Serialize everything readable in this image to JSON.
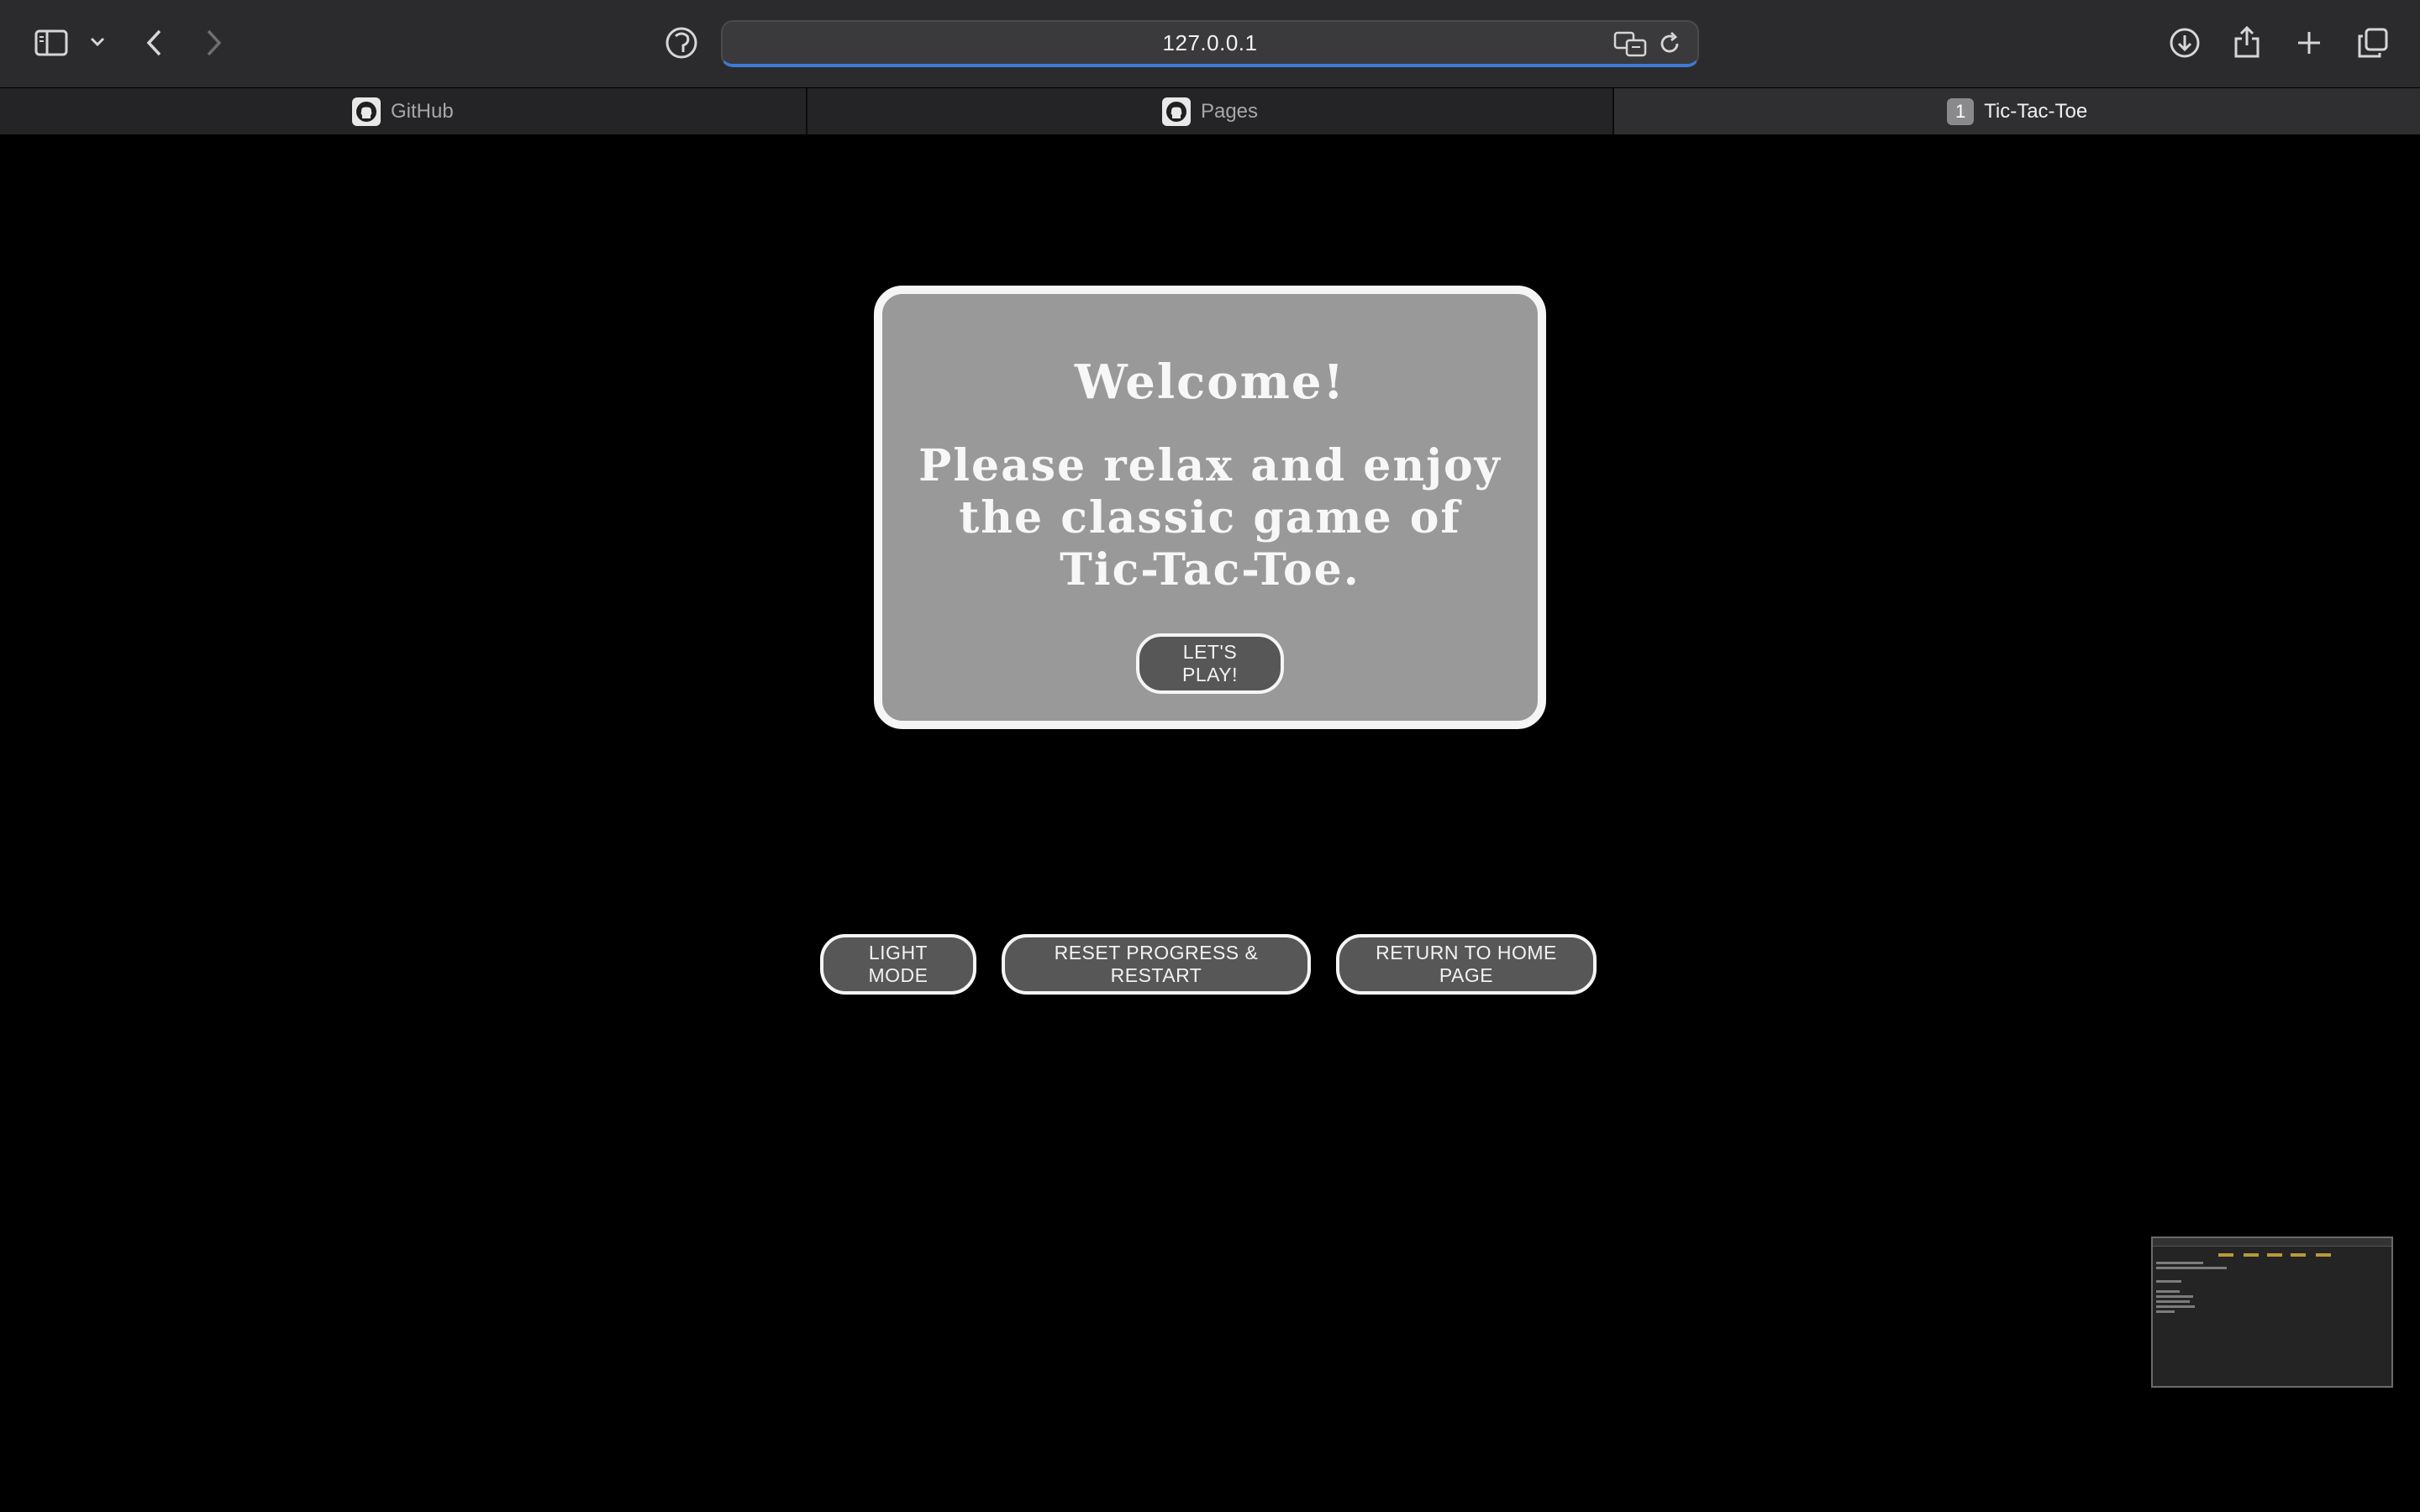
{
  "browser": {
    "url": "127.0.0.1",
    "tabs": [
      {
        "label": "GitHub",
        "icon": "github-icon",
        "active": false
      },
      {
        "label": "Pages",
        "icon": "github-icon",
        "active": false
      },
      {
        "label": "Tic-Tac-Toe",
        "badge": "1",
        "active": true
      }
    ],
    "toolbar_icons": [
      "sidebar-icon",
      "chevron-down-icon",
      "back-icon",
      "forward-icon",
      "privacy-icon",
      "translate-icon",
      "reload-icon",
      "download-icon",
      "share-icon",
      "new-tab-icon",
      "tab-overview-icon"
    ]
  },
  "welcome": {
    "title": "Welcome!",
    "message": "Please relax and enjoy the classic game of Tic-Tac-Toe.",
    "play_button": "LET'S PLAY!"
  },
  "controls": {
    "light_mode": "LIGHT MODE",
    "reset": "RESET PROGRESS & RESTART",
    "home": "RETURN TO HOME PAGE"
  },
  "colors": {
    "page_background": "#000000",
    "card_background": "#999999",
    "button_background": "#575757",
    "border": "#f5f5f5",
    "url_focus": "#3d7bd6"
  }
}
